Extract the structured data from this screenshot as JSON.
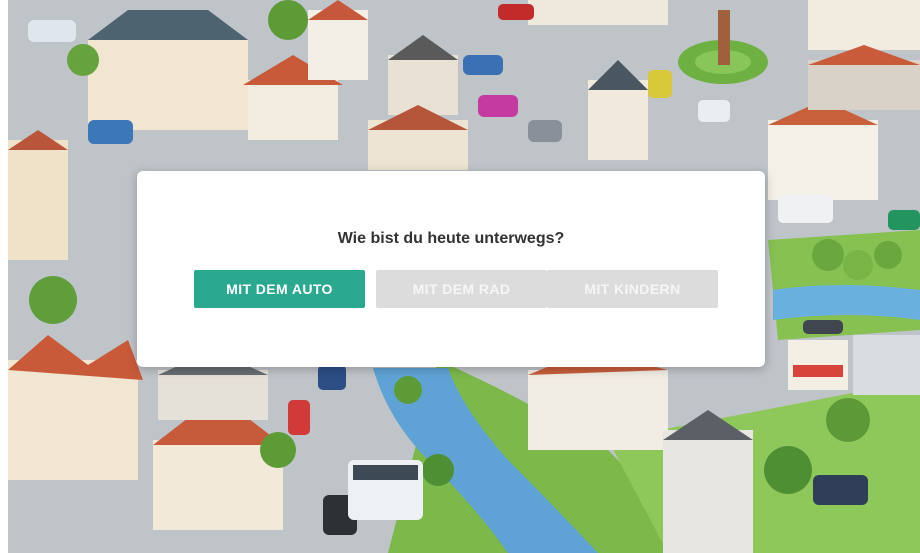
{
  "dialog": {
    "question": "Wie bist du heute unterwegs?",
    "options": [
      {
        "label": "MIT DEM AUTO",
        "state": "active"
      },
      {
        "label": "MIT DEM RAD",
        "state": "inactive"
      },
      {
        "label": "MIT KINDERN",
        "state": "inactive"
      }
    ]
  },
  "colors": {
    "primary": "#2aa890",
    "inactive": "#dcdcdc",
    "street": "#b9bec4",
    "grass": "#7cb84a",
    "river": "#5fa3d6",
    "roof": "#c85a3a"
  }
}
